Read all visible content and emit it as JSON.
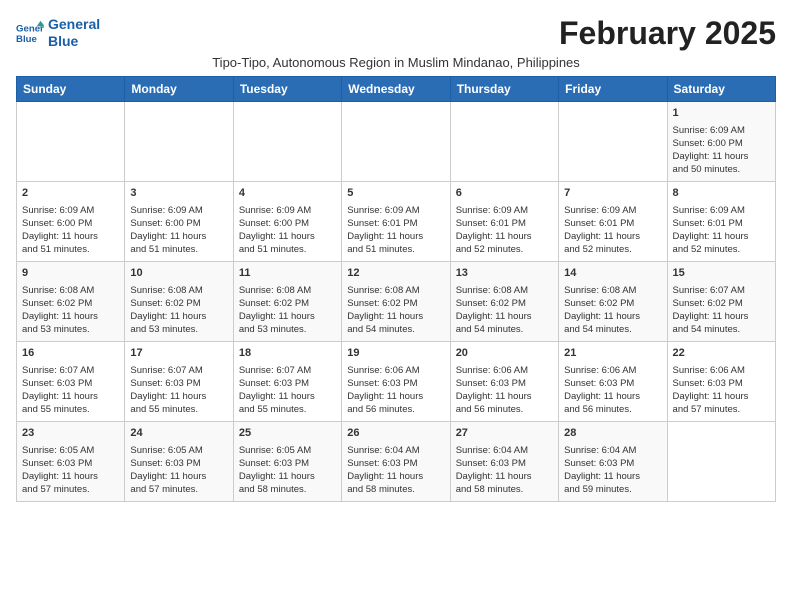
{
  "logo": {
    "line1": "General",
    "line2": "Blue"
  },
  "title": "February 2025",
  "subtitle": "Tipo-Tipo, Autonomous Region in Muslim Mindanao, Philippines",
  "days_of_week": [
    "Sunday",
    "Monday",
    "Tuesday",
    "Wednesday",
    "Thursday",
    "Friday",
    "Saturday"
  ],
  "weeks": [
    [
      {
        "day": "",
        "info": ""
      },
      {
        "day": "",
        "info": ""
      },
      {
        "day": "",
        "info": ""
      },
      {
        "day": "",
        "info": ""
      },
      {
        "day": "",
        "info": ""
      },
      {
        "day": "",
        "info": ""
      },
      {
        "day": "1",
        "info": "Sunrise: 6:09 AM\nSunset: 6:00 PM\nDaylight: 11 hours\nand 50 minutes."
      }
    ],
    [
      {
        "day": "2",
        "info": "Sunrise: 6:09 AM\nSunset: 6:00 PM\nDaylight: 11 hours\nand 51 minutes."
      },
      {
        "day": "3",
        "info": "Sunrise: 6:09 AM\nSunset: 6:00 PM\nDaylight: 11 hours\nand 51 minutes."
      },
      {
        "day": "4",
        "info": "Sunrise: 6:09 AM\nSunset: 6:00 PM\nDaylight: 11 hours\nand 51 minutes."
      },
      {
        "day": "5",
        "info": "Sunrise: 6:09 AM\nSunset: 6:01 PM\nDaylight: 11 hours\nand 51 minutes."
      },
      {
        "day": "6",
        "info": "Sunrise: 6:09 AM\nSunset: 6:01 PM\nDaylight: 11 hours\nand 52 minutes."
      },
      {
        "day": "7",
        "info": "Sunrise: 6:09 AM\nSunset: 6:01 PM\nDaylight: 11 hours\nand 52 minutes."
      },
      {
        "day": "8",
        "info": "Sunrise: 6:09 AM\nSunset: 6:01 PM\nDaylight: 11 hours\nand 52 minutes."
      }
    ],
    [
      {
        "day": "9",
        "info": "Sunrise: 6:08 AM\nSunset: 6:02 PM\nDaylight: 11 hours\nand 53 minutes."
      },
      {
        "day": "10",
        "info": "Sunrise: 6:08 AM\nSunset: 6:02 PM\nDaylight: 11 hours\nand 53 minutes."
      },
      {
        "day": "11",
        "info": "Sunrise: 6:08 AM\nSunset: 6:02 PM\nDaylight: 11 hours\nand 53 minutes."
      },
      {
        "day": "12",
        "info": "Sunrise: 6:08 AM\nSunset: 6:02 PM\nDaylight: 11 hours\nand 54 minutes."
      },
      {
        "day": "13",
        "info": "Sunrise: 6:08 AM\nSunset: 6:02 PM\nDaylight: 11 hours\nand 54 minutes."
      },
      {
        "day": "14",
        "info": "Sunrise: 6:08 AM\nSunset: 6:02 PM\nDaylight: 11 hours\nand 54 minutes."
      },
      {
        "day": "15",
        "info": "Sunrise: 6:07 AM\nSunset: 6:02 PM\nDaylight: 11 hours\nand 54 minutes."
      }
    ],
    [
      {
        "day": "16",
        "info": "Sunrise: 6:07 AM\nSunset: 6:03 PM\nDaylight: 11 hours\nand 55 minutes."
      },
      {
        "day": "17",
        "info": "Sunrise: 6:07 AM\nSunset: 6:03 PM\nDaylight: 11 hours\nand 55 minutes."
      },
      {
        "day": "18",
        "info": "Sunrise: 6:07 AM\nSunset: 6:03 PM\nDaylight: 11 hours\nand 55 minutes."
      },
      {
        "day": "19",
        "info": "Sunrise: 6:06 AM\nSunset: 6:03 PM\nDaylight: 11 hours\nand 56 minutes."
      },
      {
        "day": "20",
        "info": "Sunrise: 6:06 AM\nSunset: 6:03 PM\nDaylight: 11 hours\nand 56 minutes."
      },
      {
        "day": "21",
        "info": "Sunrise: 6:06 AM\nSunset: 6:03 PM\nDaylight: 11 hours\nand 56 minutes."
      },
      {
        "day": "22",
        "info": "Sunrise: 6:06 AM\nSunset: 6:03 PM\nDaylight: 11 hours\nand 57 minutes."
      }
    ],
    [
      {
        "day": "23",
        "info": "Sunrise: 6:05 AM\nSunset: 6:03 PM\nDaylight: 11 hours\nand 57 minutes."
      },
      {
        "day": "24",
        "info": "Sunrise: 6:05 AM\nSunset: 6:03 PM\nDaylight: 11 hours\nand 57 minutes."
      },
      {
        "day": "25",
        "info": "Sunrise: 6:05 AM\nSunset: 6:03 PM\nDaylight: 11 hours\nand 58 minutes."
      },
      {
        "day": "26",
        "info": "Sunrise: 6:04 AM\nSunset: 6:03 PM\nDaylight: 11 hours\nand 58 minutes."
      },
      {
        "day": "27",
        "info": "Sunrise: 6:04 AM\nSunset: 6:03 PM\nDaylight: 11 hours\nand 58 minutes."
      },
      {
        "day": "28",
        "info": "Sunrise: 6:04 AM\nSunset: 6:03 PM\nDaylight: 11 hours\nand 59 minutes."
      },
      {
        "day": "",
        "info": ""
      }
    ]
  ]
}
